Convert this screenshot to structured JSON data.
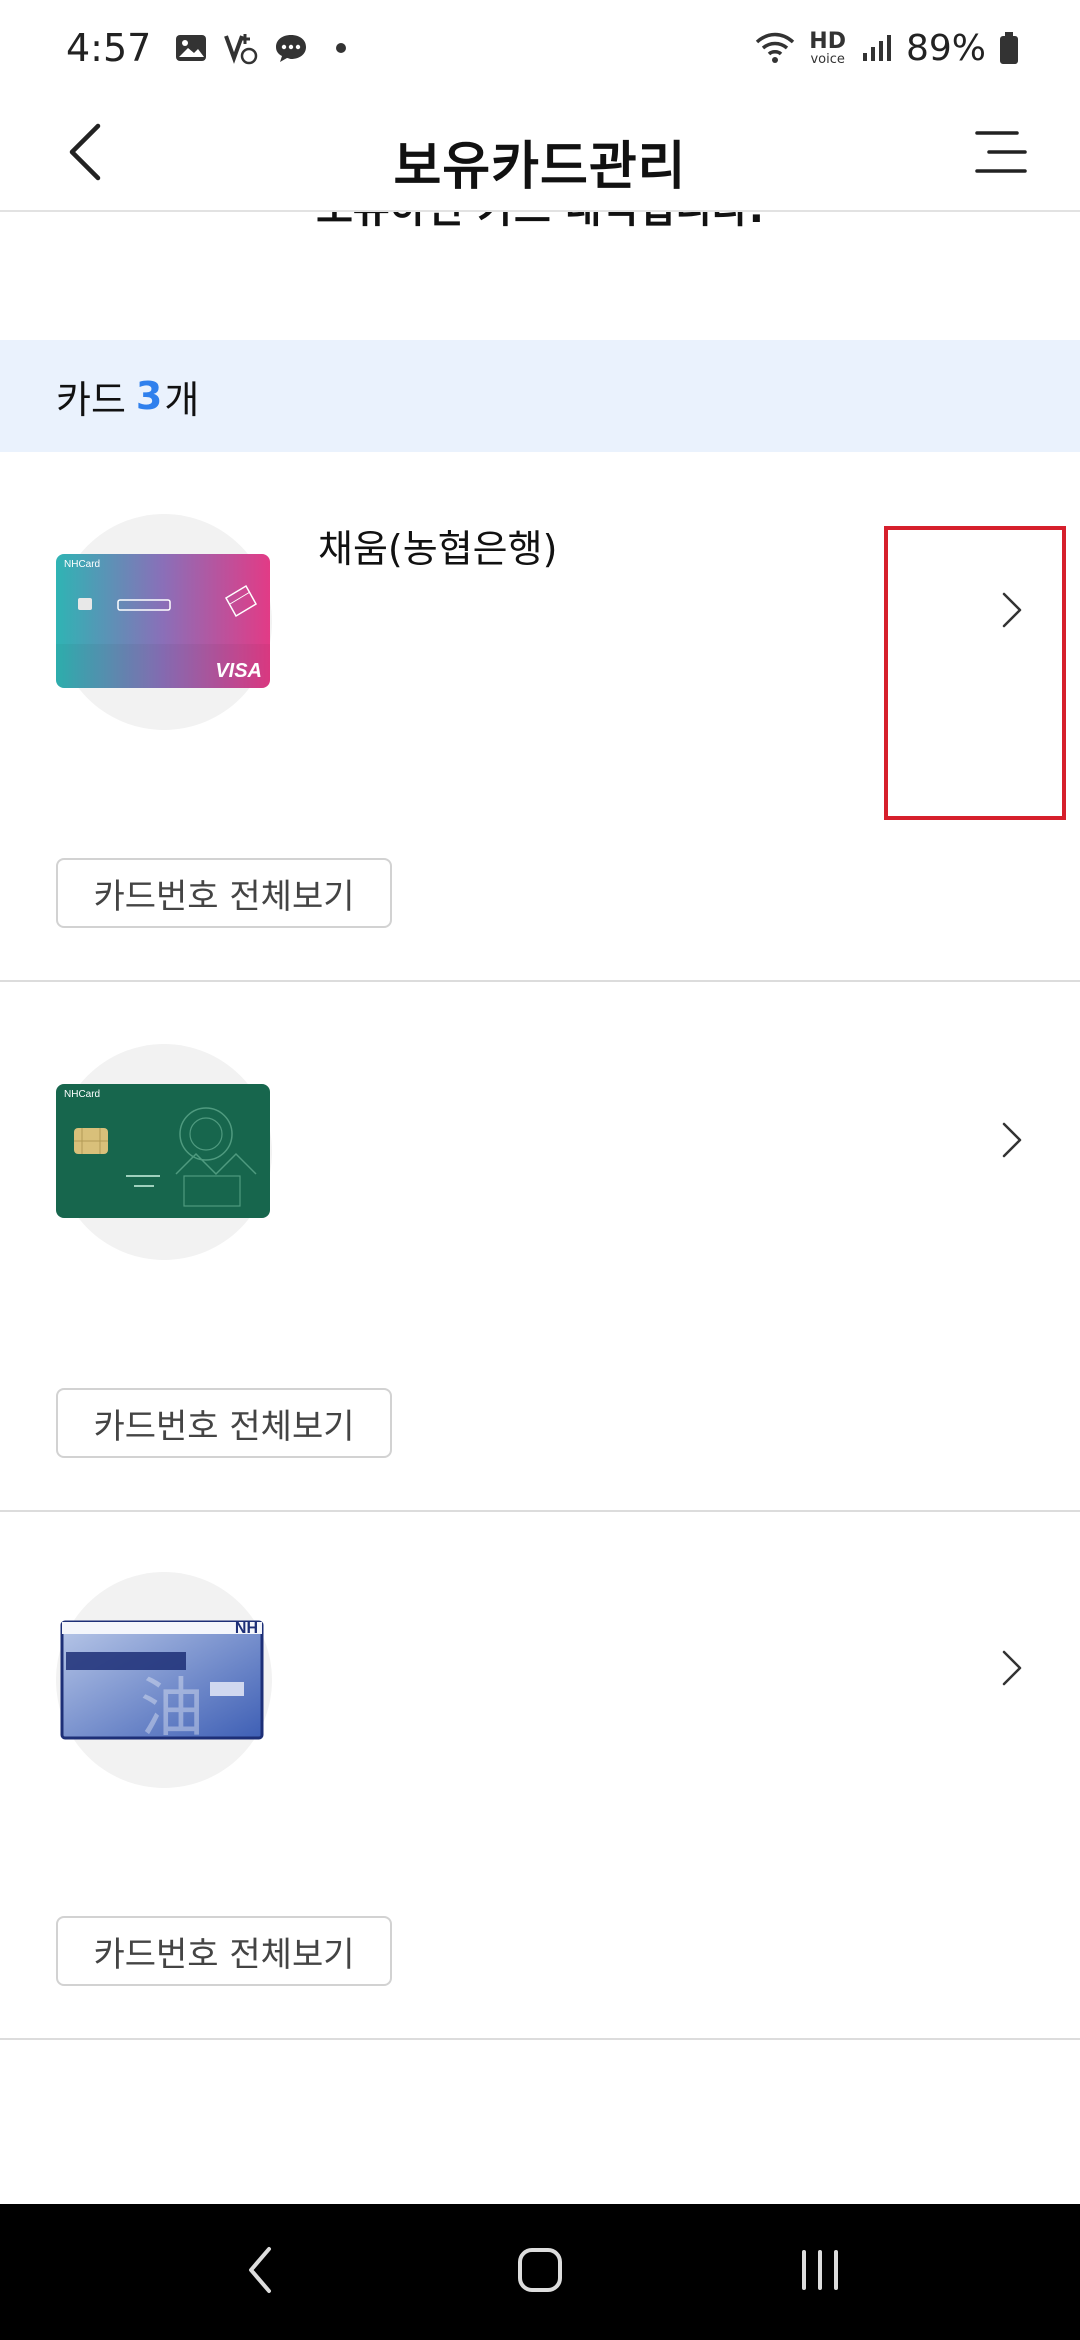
{
  "status_bar": {
    "time": "4:57",
    "battery": "89%",
    "hd_label": "HD",
    "voice_label": "voice",
    "icons": [
      "gallery-icon",
      "volte-icon",
      "chat-icon",
      "dot-icon",
      "wifi-icon",
      "signal-icon",
      "battery-icon"
    ]
  },
  "header": {
    "title": "보유카드관리",
    "back_icon": "chevron-left-icon",
    "menu_icon": "menu-icon"
  },
  "intro": {
    "text": "보유하신 카드 내역입니다."
  },
  "summary": {
    "prefix": "카드",
    "count": "3",
    "suffix": "개"
  },
  "cards": [
    {
      "name": "채움(농협은행)",
      "brand": "NHCard",
      "network": "VISA",
      "view_button": "카드번호 전체보기"
    },
    {
      "name": "",
      "brand": "NHCard",
      "view_button": "카드번호 전체보기"
    },
    {
      "name": "",
      "brand": "NH",
      "view_button": "카드번호 전체보기"
    }
  ],
  "colors": {
    "accent": "#2f80ed",
    "count_bar": "#eaf2fd",
    "highlight": "#d61f2c",
    "nav_bar": "#000000"
  }
}
